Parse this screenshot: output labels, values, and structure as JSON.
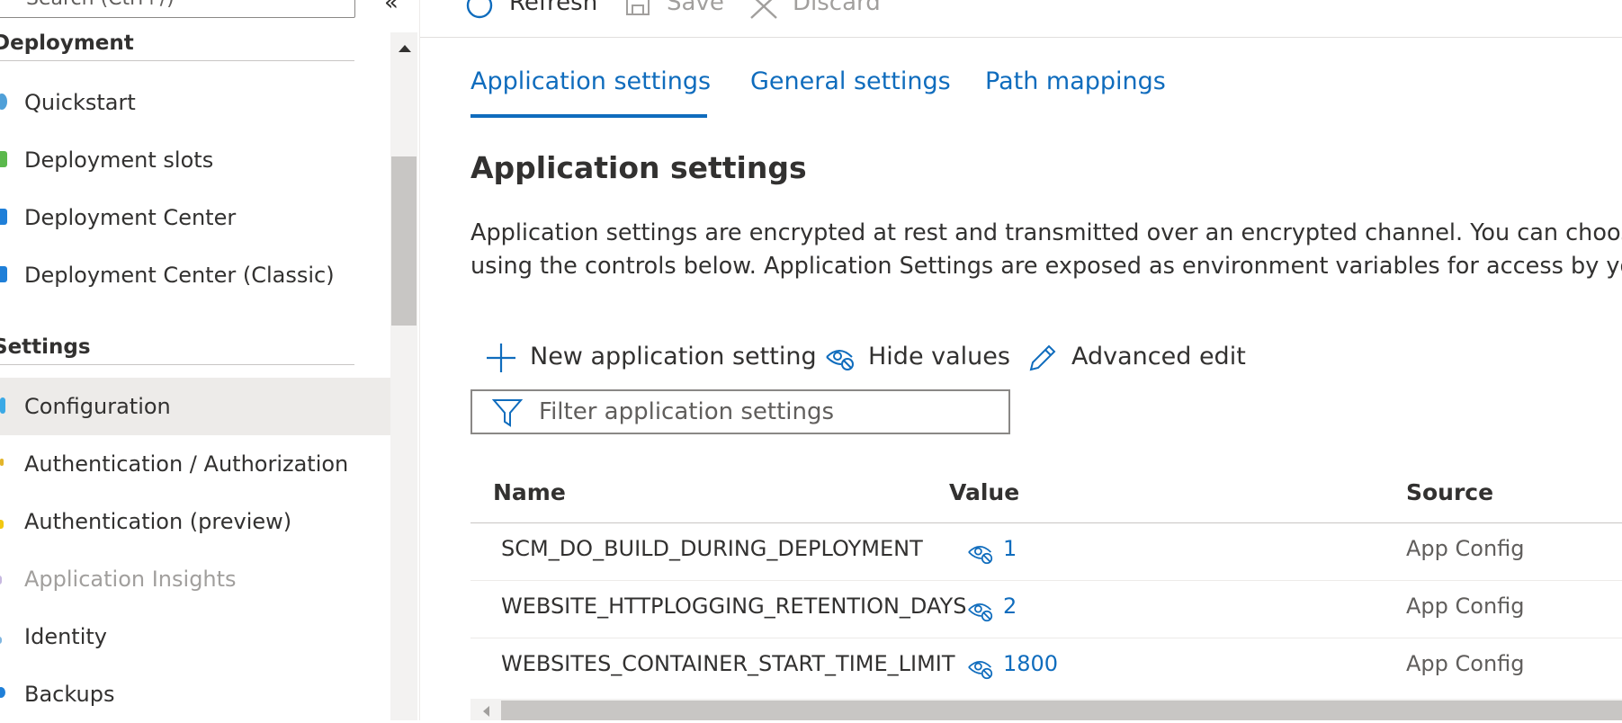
{
  "sidebar": {
    "search_placeholder": "Search (Ctrl+/)",
    "collapse_glyph": "«",
    "sections": [
      {
        "title": "Deployment"
      },
      {
        "title": "Settings"
      }
    ],
    "items": [
      {
        "label": "Quickstart",
        "icon": "cloud-icon"
      },
      {
        "label": "Deployment slots",
        "icon": "slots-icon"
      },
      {
        "label": "Deployment Center",
        "icon": "cube-icon"
      },
      {
        "label": "Deployment Center (Classic)",
        "icon": "cube-icon"
      },
      {
        "label": "Configuration",
        "icon": "config-icon"
      },
      {
        "label": "Authentication / Authorization",
        "icon": "key-icon"
      },
      {
        "label": "Authentication (preview)",
        "icon": "key-icon"
      },
      {
        "label": "Application Insights",
        "icon": "lightbulb-icon"
      },
      {
        "label": "Identity",
        "icon": "identity-icon"
      },
      {
        "label": "Backups",
        "icon": "backup-icon"
      }
    ]
  },
  "toolbar": {
    "refresh_label": "Refresh",
    "save_label": "Save",
    "discard_label": "Discard"
  },
  "tabs": [
    {
      "label": "Application settings"
    },
    {
      "label": "General settings"
    },
    {
      "label": "Path mappings"
    }
  ],
  "main": {
    "title": "Application settings",
    "description_line1": "Application settings are encrypted at rest and transmitted over an encrypted channel. You can choose to",
    "description_line2": "using the controls below. Application Settings are exposed as environment variables for access by your a"
  },
  "commands": {
    "new_label": "New application setting",
    "hide_label": "Hide values",
    "advanced_label": "Advanced edit"
  },
  "filter": {
    "placeholder": "Filter application settings"
  },
  "table": {
    "headers": {
      "name": "Name",
      "value": "Value",
      "source": "Source"
    },
    "rows": [
      {
        "name": "SCM_DO_BUILD_DURING_DEPLOYMENT",
        "value": "1",
        "source": "App Config"
      },
      {
        "name": "WEBSITE_HTTPLOGGING_RETENTION_DAYS",
        "value": "2",
        "source": "App Config"
      },
      {
        "name": "WEBSITES_CONTAINER_START_TIME_LIMIT",
        "value": "1800",
        "source": "App Config"
      }
    ]
  },
  "colors": {
    "accent": "#0f6cbd",
    "selected_bg": "#edebe9",
    "text": "#323130",
    "muted": "#605e5c"
  }
}
